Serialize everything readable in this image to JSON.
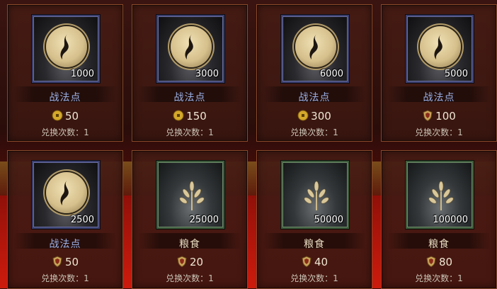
{
  "items": [
    {
      "name": "战法点",
      "quantity": "1000",
      "currency": "coin",
      "price": "50",
      "limit": "兑换次数：1",
      "icon": "tactic-point-icon"
    },
    {
      "name": "战法点",
      "quantity": "3000",
      "currency": "coin",
      "price": "150",
      "limit": "兑换次数：1",
      "icon": "tactic-point-icon"
    },
    {
      "name": "战法点",
      "quantity": "6000",
      "currency": "coin",
      "price": "300",
      "limit": "兑换次数：1",
      "icon": "tactic-point-icon"
    },
    {
      "name": "战法点",
      "quantity": "5000",
      "currency": "shield-token",
      "price": "100",
      "limit": "兑换次数：1",
      "icon": "tactic-point-icon"
    },
    {
      "name": "战法点",
      "quantity": "2500",
      "currency": "shield-token",
      "price": "50",
      "limit": "兑换次数：1",
      "icon": "tactic-point-icon"
    },
    {
      "name": "粮食",
      "quantity": "25000",
      "currency": "shield-token",
      "price": "20",
      "limit": "兑换次数：1",
      "icon": "grain-icon"
    },
    {
      "name": "粮食",
      "quantity": "50000",
      "currency": "shield-token",
      "price": "40",
      "limit": "兑换次数：1",
      "icon": "grain-icon"
    },
    {
      "name": "粮食",
      "quantity": "100000",
      "currency": "shield-token",
      "price": "80",
      "limit": "兑换次数：1",
      "icon": "grain-icon"
    }
  ],
  "colors": {
    "tactic_name": "#9bb0e6",
    "food_name": "#e8dcc0",
    "coin": "#d4a82a",
    "shield_token": "#c9a45a"
  }
}
